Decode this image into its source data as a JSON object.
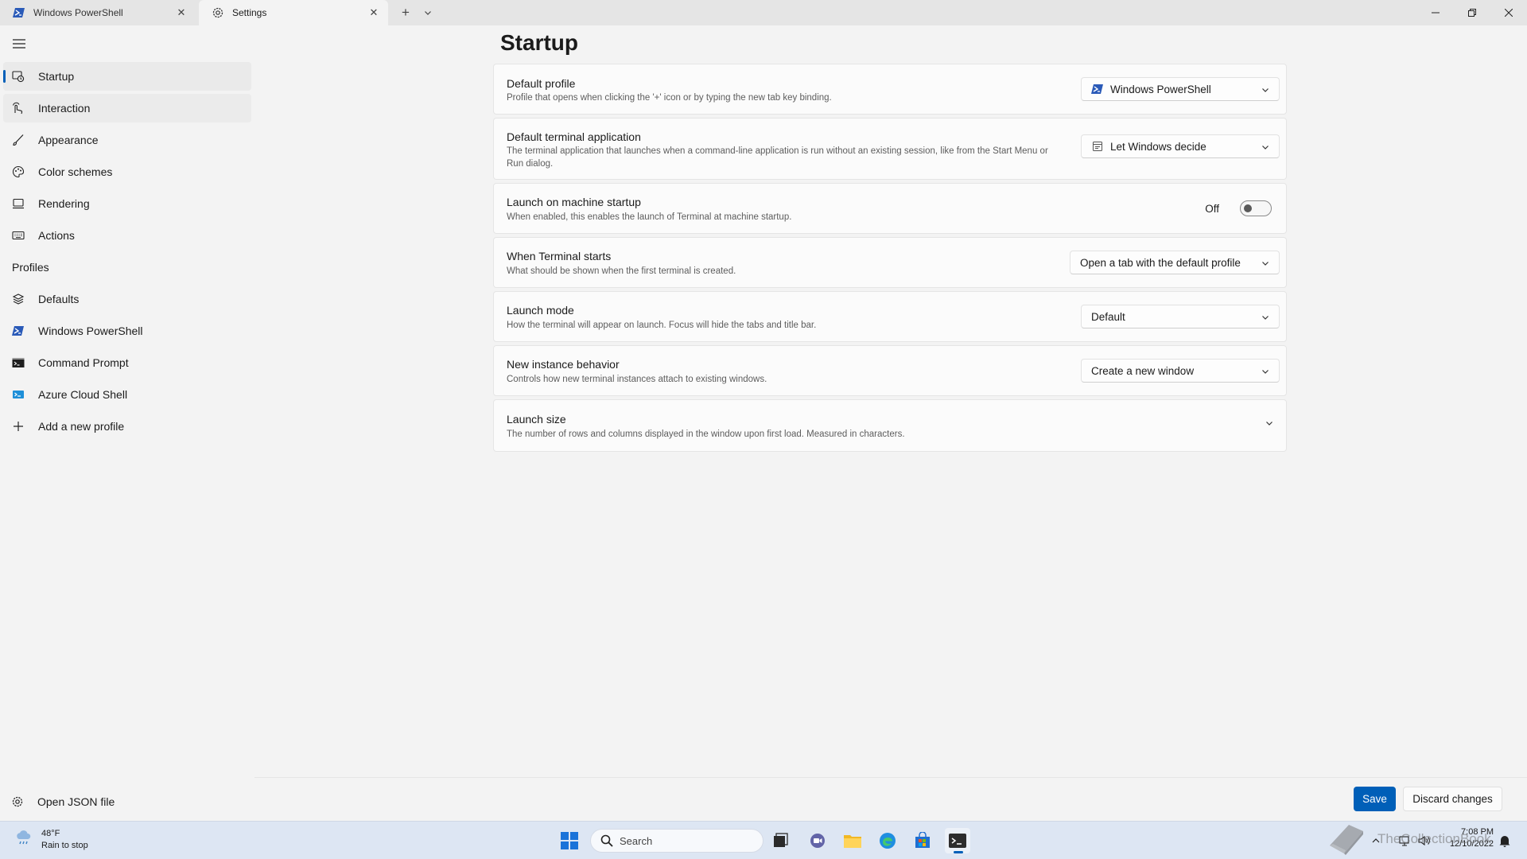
{
  "tabs": [
    {
      "title": "Windows PowerShell",
      "icon": "powershell-icon"
    },
    {
      "title": "Settings",
      "icon": "gear-icon"
    }
  ],
  "sidebar": {
    "items": [
      {
        "label": "Startup",
        "icon": "startup-icon"
      },
      {
        "label": "Interaction",
        "icon": "interaction-icon"
      },
      {
        "label": "Appearance",
        "icon": "brush-icon"
      },
      {
        "label": "Color schemes",
        "icon": "palette-icon"
      },
      {
        "label": "Rendering",
        "icon": "monitor-icon"
      },
      {
        "label": "Actions",
        "icon": "keyboard-icon"
      }
    ],
    "profiles_header": "Profiles",
    "profiles": [
      {
        "label": "Defaults",
        "icon": "layers-icon"
      },
      {
        "label": "Windows PowerShell",
        "icon": "powershell-icon"
      },
      {
        "label": "Command Prompt",
        "icon": "cmd-icon"
      },
      {
        "label": "Azure Cloud Shell",
        "icon": "azure-icon"
      },
      {
        "label": "Add a new profile",
        "icon": "plus-icon"
      }
    ],
    "open_json": "Open JSON file"
  },
  "page": {
    "title": "Startup",
    "settings": [
      {
        "title": "Default profile",
        "description": "Profile that opens when clicking the '+' icon or by typing the new tab key binding.",
        "value": "Windows PowerShell"
      },
      {
        "title": "Default terminal application",
        "description": "The terminal application that launches when a command-line application is run without an existing session, like from the Start Menu or Run dialog.",
        "value": "Let Windows decide"
      },
      {
        "title": "Launch on machine startup",
        "description": "When enabled, this enables the launch of Terminal at machine startup.",
        "toggle_label": "Off",
        "toggle_on": false
      },
      {
        "title": "When Terminal starts",
        "description": "What should be shown when the first terminal is created.",
        "value": "Open a tab with the default profile"
      },
      {
        "title": "Launch mode",
        "description": "How the terminal will appear on launch. Focus will hide the tabs and title bar.",
        "value": "Default"
      },
      {
        "title": "New instance behavior",
        "description": "Controls how new terminal instances attach to existing windows.",
        "value": "Create a new window"
      },
      {
        "title": "Launch size",
        "description": "The number of rows and columns displayed in the window upon first load. Measured in characters."
      }
    ]
  },
  "actions": {
    "save": "Save",
    "discard": "Discard changes"
  },
  "taskbar": {
    "weather_temp": "48°F",
    "weather_desc": "Rain to stop",
    "search_placeholder": "Search",
    "time": "7:08 PM",
    "date": "12/10/2022",
    "watermark": "TheCollectionBook"
  },
  "colors": {
    "accent": "#005fb8",
    "background": "#f3f3f3",
    "card": "#fbfbfb"
  }
}
